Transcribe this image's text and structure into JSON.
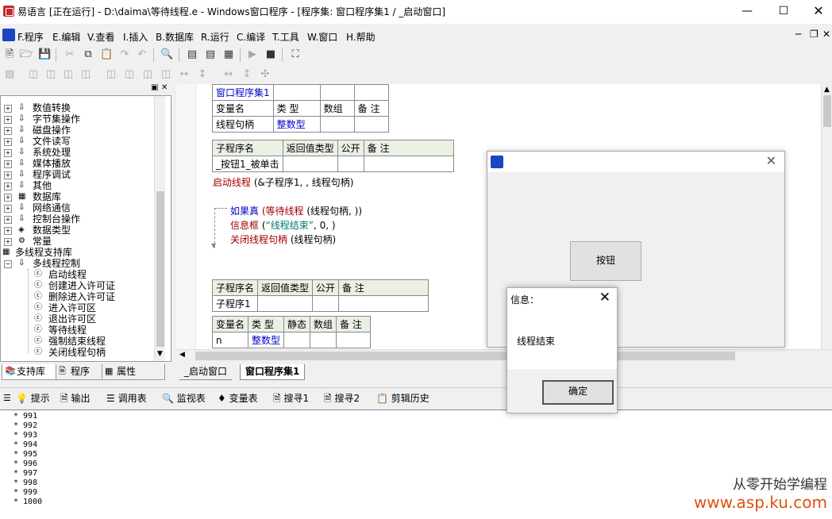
{
  "window": {
    "title": "易语言 [正在运行] - D:\\daima\\等待线程.e - Windows窗口程序 - [程序集: 窗口程序集1 / _启动窗口]"
  },
  "menu": {
    "items": [
      "F.程序",
      "E.编辑",
      "V.查看",
      "I.插入",
      "B.数据库",
      "R.运行",
      "C.编译",
      "T.工具",
      "W.窗口",
      "H.帮助"
    ]
  },
  "tree": {
    "items": [
      {
        "label": "数值转换"
      },
      {
        "label": "字节集操作"
      },
      {
        "label": "磁盘操作"
      },
      {
        "label": "文件读写"
      },
      {
        "label": "系统处理"
      },
      {
        "label": "媒体播放"
      },
      {
        "label": "程序调试"
      },
      {
        "label": "其他"
      },
      {
        "label": "数据库"
      },
      {
        "label": "网络通信"
      },
      {
        "label": "控制台操作"
      },
      {
        "label": "数据类型"
      },
      {
        "label": "常量"
      },
      {
        "label": "多线程支持库"
      },
      {
        "label": "多线程控制"
      },
      {
        "label": "启动线程"
      },
      {
        "label": "创建进入许可证"
      },
      {
        "label": "删除进入许可证"
      },
      {
        "label": "进入许可区"
      },
      {
        "label": "退出许可区"
      },
      {
        "label": "等待线程"
      },
      {
        "label": "强制结束线程"
      },
      {
        "label": "关闭线程句柄"
      }
    ]
  },
  "panel_tabs": [
    "支持库",
    "程序",
    "属性"
  ],
  "editor": {
    "assembly_table": {
      "name": "窗口程序集1",
      "headers": [
        "变量名",
        "类 型",
        "数组",
        "备 注"
      ],
      "row": [
        "线程句柄",
        "整数型",
        "",
        ""
      ]
    },
    "sub1": {
      "headers": [
        "子程序名",
        "返回值类型",
        "公开",
        "备 注"
      ],
      "name": "_按钮1_被单击"
    },
    "code": {
      "line1_fn": "启动线程",
      "line1_args": " (&子程序1, , 线程句柄)",
      "if_kw": "如果真",
      "if_fn": " (等待线程",
      "if_args": " (线程句柄, ))",
      "msg_fn": "信息框",
      "msg_open": " (",
      "msg_str": "“线程结束”",
      "msg_rest": ", 0, )",
      "close_fn": "关闭线程句柄",
      "close_args": " (线程句柄)"
    },
    "sub2": {
      "headers": [
        "子程序名",
        "返回值类型",
        "公开",
        "备 注"
      ],
      "name": "子程序1"
    },
    "local_vars": {
      "headers": [
        "变量名",
        "类 型",
        "静态",
        "数组",
        "备 注"
      ],
      "row": [
        "n",
        "整数型",
        "",
        "",
        ""
      ]
    }
  },
  "editor_tabs": [
    "_启动窗口",
    "窗口程序集1"
  ],
  "bottom_tabs": [
    "提示",
    "输出",
    "调用表",
    "监视表",
    "变量表",
    "搜寻1",
    "搜寻2",
    "剪辑历史"
  ],
  "output_lines": [
    "* 991",
    "* 992",
    "* 993",
    "* 994",
    "* 995",
    "* 996",
    "* 997",
    "* 998",
    "* 999",
    "* 1000"
  ],
  "child_window": {
    "button_label": "按钮"
  },
  "message_box": {
    "title": "信息：",
    "text": "线程结束",
    "ok_label": "确定"
  },
  "watermark": {
    "line1": "从零开始学编程",
    "line2": "www.asp.ku.com"
  }
}
